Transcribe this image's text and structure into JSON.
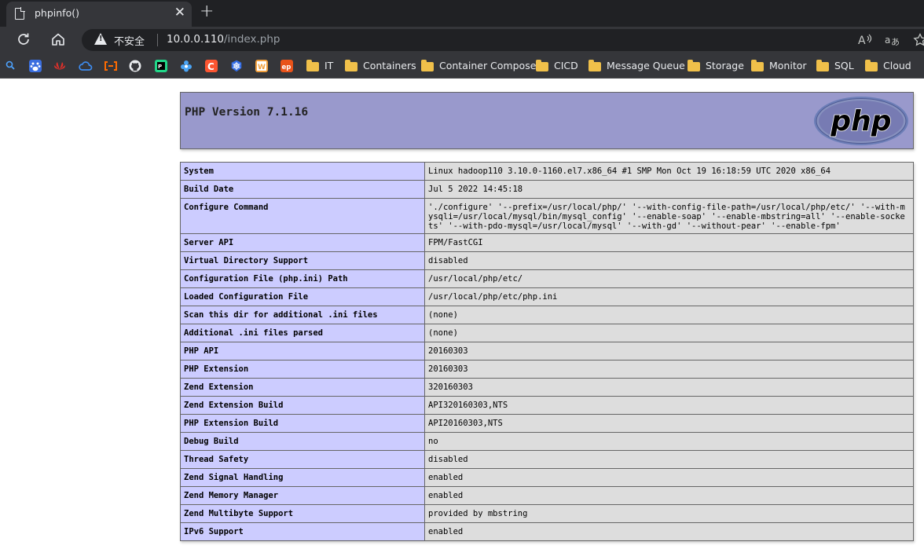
{
  "browser": {
    "tab_title": "phpinfo()",
    "close_glyph": "✕",
    "new_tab_glyph": "+",
    "address": {
      "security_label": "不安全",
      "host": "10.0.0.110",
      "path": "/index.php"
    },
    "toolbar_icons": [
      "reload-icon",
      "home-icon",
      "read-aloud-icon",
      "translate-icon",
      "favorite-icon"
    ],
    "bookmark_icons": [
      {
        "name": "search-bookmark-icon",
        "color": "#4da3ff"
      },
      {
        "name": "baidu-bookmark-icon",
        "color": "#3b6fe0"
      },
      {
        "name": "huawei-bookmark-icon",
        "color": "#e0302a"
      },
      {
        "name": "cloud-bookmark-icon",
        "color": "#3d8cf0"
      },
      {
        "name": "aliyun-bookmark-icon",
        "color": "#ff6a00"
      },
      {
        "name": "github-bookmark-icon",
        "color": "#e8eaed"
      },
      {
        "name": "pycharm-bookmark-icon",
        "color": "#21d789"
      },
      {
        "name": "flower-bookmark-icon",
        "color": "#4aa4f5"
      },
      {
        "name": "csdn-bookmark-icon",
        "color": "#fc5531"
      },
      {
        "name": "kubernetes-bookmark-icon",
        "color": "#326ce5"
      },
      {
        "name": "office-bookmark-icon",
        "color": "#f2a03d"
      },
      {
        "name": "ep-bookmark-icon",
        "color": "#e9531a"
      }
    ],
    "bookmark_folders": [
      "IT",
      "Containers",
      "Container Compose",
      "CICD",
      "Message Queue",
      "Storage",
      "Monitor",
      "SQL",
      "Cloud"
    ],
    "colors": {
      "tabstrip": "#202124",
      "toolbar": "#35363a",
      "folder": "#f0c04a"
    }
  },
  "phpinfo": {
    "title": "PHP Version 7.1.16",
    "logo_text": "php",
    "colors": {
      "header": "#9999cc",
      "key_cell": "#ccccff",
      "value_cell": "#dddddd"
    },
    "rows": [
      {
        "key": "System",
        "value": "Linux hadoop110 3.10.0-1160.el7.x86_64 #1 SMP Mon Oct 19 16:18:59 UTC 2020 x86_64"
      },
      {
        "key": "Build Date",
        "value": "Jul 5 2022 14:45:18"
      },
      {
        "key": "Configure Command",
        "value": "'./configure' '--prefix=/usr/local/php/' '--with-config-file-path=/usr/local/php/etc/' '--with-mysqli=/usr/local/mysql/bin/mysql_config' '--enable-soap' '--enable-mbstring=all' '--enable-sockets' '--with-pdo-mysql=/usr/local/mysql' '--with-gd' '--without-pear' '--enable-fpm'"
      },
      {
        "key": "Server API",
        "value": "FPM/FastCGI"
      },
      {
        "key": "Virtual Directory Support",
        "value": "disabled"
      },
      {
        "key": "Configuration File (php.ini) Path",
        "value": "/usr/local/php/etc/"
      },
      {
        "key": "Loaded Configuration File",
        "value": "/usr/local/php/etc/php.ini"
      },
      {
        "key": "Scan this dir for additional .ini files",
        "value": "(none)"
      },
      {
        "key": "Additional .ini files parsed",
        "value": "(none)"
      },
      {
        "key": "PHP API",
        "value": "20160303"
      },
      {
        "key": "PHP Extension",
        "value": "20160303"
      },
      {
        "key": "Zend Extension",
        "value": "320160303"
      },
      {
        "key": "Zend Extension Build",
        "value": "API320160303,NTS"
      },
      {
        "key": "PHP Extension Build",
        "value": "API20160303,NTS"
      },
      {
        "key": "Debug Build",
        "value": "no"
      },
      {
        "key": "Thread Safety",
        "value": "disabled"
      },
      {
        "key": "Zend Signal Handling",
        "value": "enabled"
      },
      {
        "key": "Zend Memory Manager",
        "value": "enabled"
      },
      {
        "key": "Zend Multibyte Support",
        "value": "provided by mbstring"
      },
      {
        "key": "IPv6 Support",
        "value": "enabled"
      }
    ]
  }
}
